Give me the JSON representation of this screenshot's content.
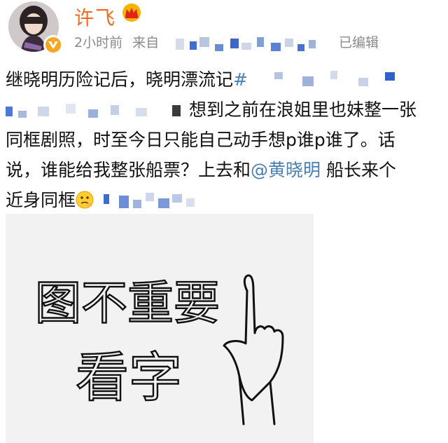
{
  "post": {
    "author": {
      "name": "许飞",
      "avatar_icon": "avatar-portrait",
      "verified_icon": "verified-badge-icon",
      "member_icon": "crown-icon"
    },
    "meta": {
      "time": "2小时前",
      "source_prefix": "来自",
      "edited": "已编辑"
    },
    "text": {
      "line1": "继晓明历险记后，晓明漂流记",
      "hashtag_start": "#",
      "line2": "想到之前在浪姐里也妹整一张",
      "line3": "同框剧照，时至今日只能自己动手想p谁p谁了。话",
      "line4_a": "说，谁能给我整张船票？上去和",
      "mention": "@黄晓明",
      "line4_b": " 船长来个",
      "line5": "近身同框"
    },
    "image": {
      "handwriting_line1": "图不重要",
      "handwriting_line2": "看字"
    },
    "colors": {
      "name": "#f26b21",
      "meta": "#8a8a8a",
      "link": "#4a7fb6",
      "text": "#111111"
    }
  }
}
